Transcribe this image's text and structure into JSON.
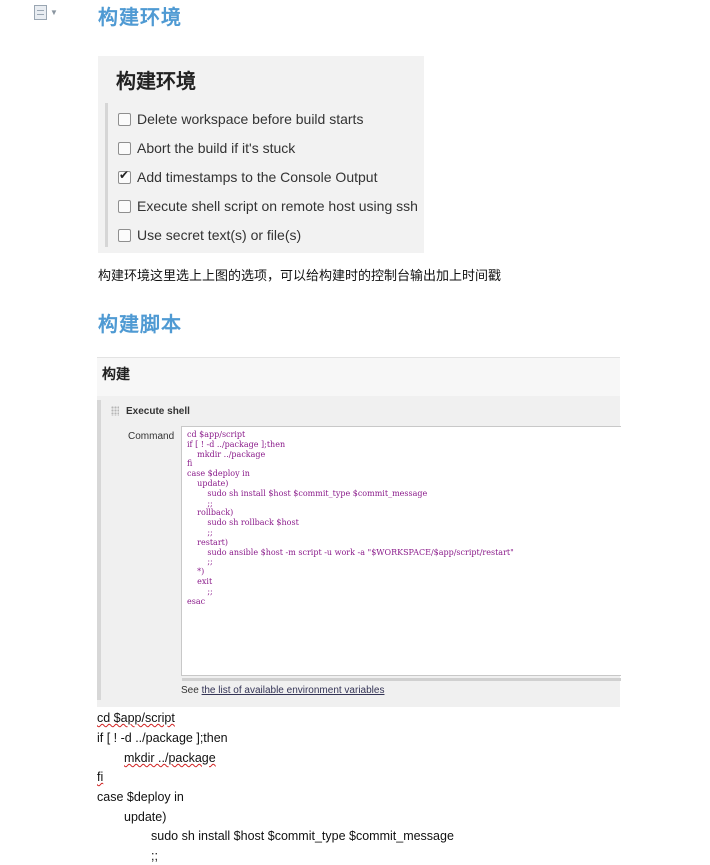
{
  "section_build_env": {
    "heading": "构建环境",
    "panel": {
      "title": "构建环境",
      "options": [
        {
          "label": "Delete workspace before build starts",
          "checked": false
        },
        {
          "label": "Abort the build if it's stuck",
          "checked": false
        },
        {
          "label": "Add timestamps to the Console Output",
          "checked": true
        },
        {
          "label": "Execute shell script on remote host using ssh",
          "checked": false
        },
        {
          "label": "Use secret text(s) or file(s)",
          "checked": false
        }
      ]
    },
    "caption": "构建环境这里选上上图的选项，可以给构建时的控制台输出加上时间戳"
  },
  "section_build_script": {
    "heading": "构建脚本",
    "panel": {
      "title": "构建",
      "step_title": "Execute shell",
      "command_label": "Command",
      "code_lines": [
        "cd $app/script",
        "if [ ! -d ../package ];then",
        "    mkdir ../package",
        "fi",
        "case $deploy in",
        "    update)",
        "        sudo sh install $host $commit_type $commit_message",
        "        ;;",
        "    rollback)",
        "        sudo sh rollback $host",
        "        ;;",
        "    restart)",
        "        sudo ansible $host -m script -u work -a \"$WORKSPACE/$app/script/restart\"",
        "        ;;",
        "    *)",
        "    exit",
        "        ;;",
        "esac"
      ],
      "see_prefix": "See",
      "see_link": "the list of available environment variables"
    },
    "plain_lines": [
      "cd $app/script",
      "if [ ! -d ../package ];then",
      "mkdir ../package",
      "fi",
      "case $deploy in",
      "update)",
      "sudo sh install $host $commit_type $commit_message",
      ";;"
    ]
  }
}
